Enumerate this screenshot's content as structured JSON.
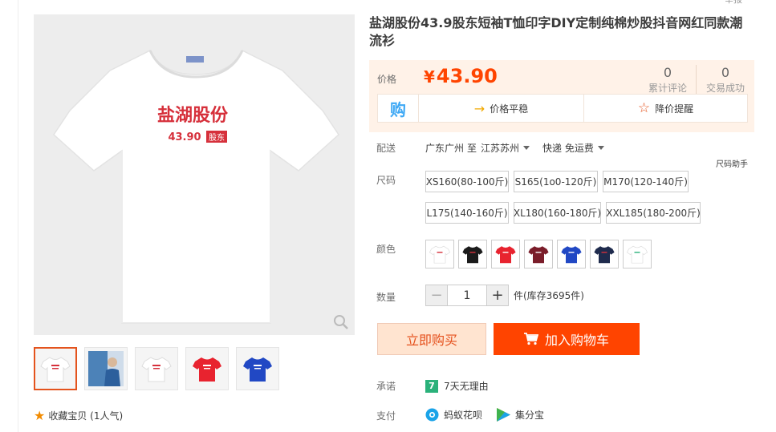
{
  "top_link": "举报",
  "gallery": {
    "main_shirt_brand": "盐湖股份",
    "main_shirt_price": "43.90",
    "main_shirt_tag": "股东",
    "thumbnails": [
      {
        "name": "thumb-white-shirt",
        "color": "#ffffff"
      },
      {
        "name": "thumb-model-photo",
        "color": "#4c82b8"
      },
      {
        "name": "thumb-white-shirt-2",
        "color": "#ffffff"
      },
      {
        "name": "thumb-red-shirt",
        "color": "#e8232f"
      },
      {
        "name": "thumb-blue-shirt",
        "color": "#2148c4"
      }
    ],
    "favorite_text": "收藏宝贝 (1人气)"
  },
  "product": {
    "title": "盐湖股份43.9股东短袖T恤印字DIY定制纯棉炒股抖音网红同款潮流衫"
  },
  "price_box": {
    "label": "价格",
    "currency": "¥",
    "price": "43.90",
    "reviews_count": "0",
    "reviews_label": "累计评论",
    "deals_count": "0",
    "deals_label": "交易成功",
    "gou_icon_text": "购",
    "trend_text": "价格平稳",
    "alert_text": "降价提醒"
  },
  "shipping": {
    "label": "配送",
    "from": "广东广州",
    "to_word": "至",
    "to": "江苏苏州",
    "method": "快递 免运费"
  },
  "size_helper": "尺码助手",
  "sizes": {
    "label": "尺码",
    "options": [
      "XS160(80-100斤)",
      "S165(1o0-120斤)",
      "M170(120-140斤)",
      "L175(140-160斤)",
      "XL180(160-180斤)",
      "XXL185(180-200斤)"
    ]
  },
  "colors": {
    "label": "颜色",
    "swatches": [
      "#ffffff",
      "#1b1b1b",
      "#e8232f",
      "#7a1d2a",
      "#2148c4",
      "#1f2b4d",
      "#ffffff"
    ]
  },
  "quantity": {
    "label": "数量",
    "value": "1",
    "minus": "−",
    "plus": "+",
    "stock_text": "件(库存3695件)"
  },
  "actions": {
    "buy_now": "立即购买",
    "add_cart": "加入购物车"
  },
  "promise": {
    "label": "承诺",
    "icon_text": "7",
    "text": "7天无理由"
  },
  "payment": {
    "label": "支付",
    "methods": [
      "蚂蚁花呗",
      "集分宝"
    ]
  },
  "accent_colors": {
    "price": "#ff4400",
    "add_cart": "#ff4400",
    "buy_now_bg": "#ffe4d0",
    "price_box_bg": "#fff2e8"
  }
}
